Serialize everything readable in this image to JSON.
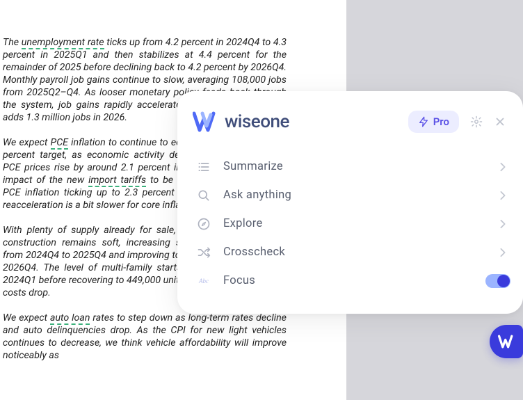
{
  "article": {
    "p1_a": "The ",
    "p1_b": "unemployment rate",
    "p1_c": " ticks up from 4.2 percent in 2024Q4 to 4.3 percent in 2025Q1 and then stabilizes at 4.4 percent for the remainder of 2025 before declining back to 4.2 percent by 2026Q4. Monthly payroll job gains continue to slow, averaging 108,000 jobs from 2025Q2–Q4. As looser monetary policy feeds back through the system, job gains rapidly accelerate in 2026. The economy adds 1.3 million jobs in 2026.",
    "p2_a": "We expect ",
    "p2_b": "PCE",
    "p2_c": " inflation to continue to edge towards the Fed's 2.0 percent target, as economic activity decelerates. Year-over-year PCE prices rise by around 2.1 percent in 2025. We expect some impact of the new ",
    "p2_d": "import tariffs",
    "p2_e": " to be manifested in 2026, with PCE inflation ticking up to 2.3 percent in the end of 2026. The reacceleration is a bit slower for core inflation.",
    "p3": "With plenty of supply already for sale, the pace of multi-home construction remains soft, increasing slightly to 991,000 units from 2024Q4 to 2025Q4 and improving to a 1,080,000 unit pace by 2026Q4. The level of multi-family starts bottoms at 350,000 in 2024Q1 before recovering to 449,000 units by 2026Q4 as financing costs drop.",
    "p4_a": "We expect ",
    "p4_b": "auto loan",
    "p4_c": " rates to step down as long-term rates decline and auto delinquencies drop. As the CPI for new light vehicles continues to decrease, we think vehicle affordability will improve noticeably as"
  },
  "popup": {
    "brand": "wiseone",
    "pro_label": "Pro",
    "items": [
      {
        "label": "Summarize",
        "key": "summarize"
      },
      {
        "label": "Ask anything",
        "key": "ask"
      },
      {
        "label": "Explore",
        "key": "explore"
      },
      {
        "label": "Crosscheck",
        "key": "crosscheck"
      },
      {
        "label": "Focus",
        "key": "focus"
      }
    ],
    "focus_on": true
  }
}
